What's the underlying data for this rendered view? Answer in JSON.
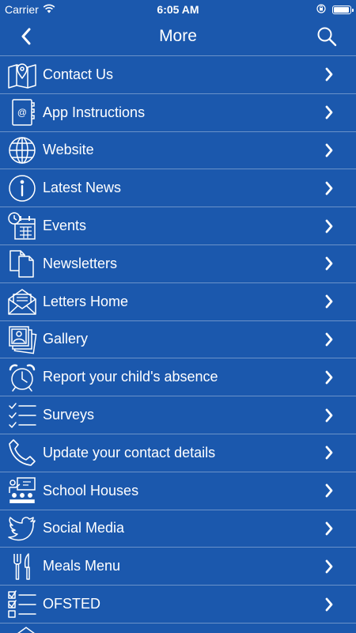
{
  "status_bar": {
    "carrier": "Carrier",
    "time": "6:05 AM"
  },
  "nav": {
    "title": "More"
  },
  "menu": {
    "items": [
      {
        "label": "Contact Us",
        "icon": "map-icon"
      },
      {
        "label": "App Instructions",
        "icon": "address-book-icon"
      },
      {
        "label": "Website",
        "icon": "globe-icon"
      },
      {
        "label": "Latest News",
        "icon": "info-icon"
      },
      {
        "label": "Events",
        "icon": "calendar-clock-icon"
      },
      {
        "label": "Newsletters",
        "icon": "documents-icon"
      },
      {
        "label": "Letters Home",
        "icon": "envelope-icon"
      },
      {
        "label": "Gallery",
        "icon": "photos-icon"
      },
      {
        "label": "Report your child's absence",
        "icon": "alarm-clock-icon"
      },
      {
        "label": "Surveys",
        "icon": "checklist-icon"
      },
      {
        "label": "Update your contact details",
        "icon": "phone-icon"
      },
      {
        "label": "School Houses",
        "icon": "classroom-icon"
      },
      {
        "label": "Social Media",
        "icon": "twitter-bird-icon"
      },
      {
        "label": "Meals Menu",
        "icon": "fork-knife-icon"
      },
      {
        "label": "OFSTED",
        "icon": "checkbox-list-icon"
      }
    ]
  },
  "colors": {
    "background": "#1b58ad",
    "foreground": "#ffffff",
    "divider": "rgba(255,255,255,0.35)"
  }
}
